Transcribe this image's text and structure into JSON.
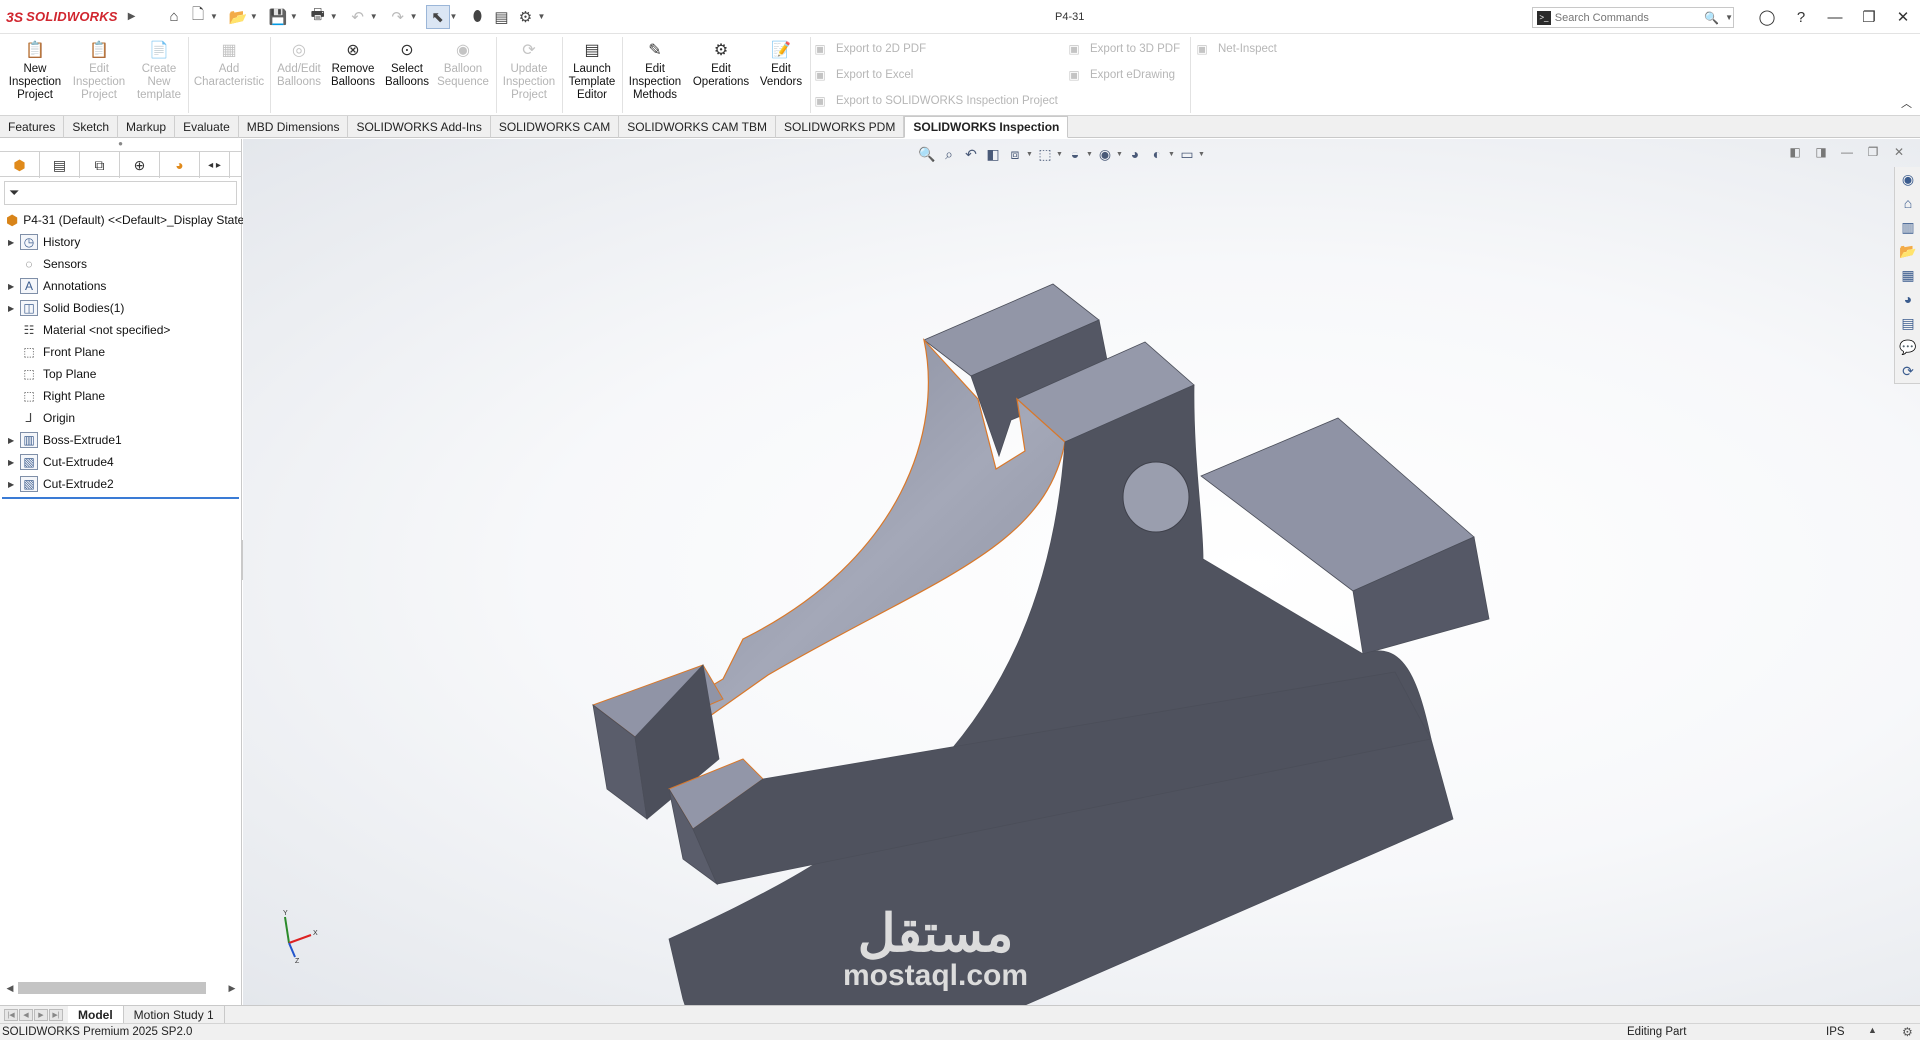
{
  "app": {
    "brand_ds": "3S",
    "brand_name": "SOLIDWORKS",
    "doc_title": "P4-31"
  },
  "search": {
    "placeholder": "Search Commands"
  },
  "ribbon": {
    "new_project": [
      "New",
      "Inspection",
      "Project"
    ],
    "edit_project": [
      "Edit",
      "Inspection",
      "Project"
    ],
    "create_template": [
      "Create",
      "New",
      "template"
    ],
    "add_characteristic": [
      "Add",
      "Characteristic"
    ],
    "add_edit_balloons": [
      "Add/Edit",
      "Balloons"
    ],
    "remove_balloons": [
      "Remove",
      "Balloons"
    ],
    "select_balloons": [
      "Select",
      "Balloons"
    ],
    "balloon_sequence": [
      "Balloon",
      "Sequence"
    ],
    "update_project": [
      "Update",
      "Inspection",
      "Project"
    ],
    "launch_template": [
      "Launch",
      "Template",
      "Editor"
    ],
    "edit_methods": [
      "Edit",
      "Inspection",
      "Methods"
    ],
    "edit_operations": [
      "Edit",
      "Operations"
    ],
    "edit_vendors": [
      "Edit",
      "Vendors"
    ],
    "export_2d_pdf": "Export to 2D PDF",
    "export_excel": "Export to Excel",
    "export_sw_inspection": "Export to SOLIDWORKS Inspection Project",
    "export_3d_pdf": "Export to 3D PDF",
    "export_edrawing": "Export eDrawing",
    "net_inspect": "Net-Inspect"
  },
  "tabs": [
    "Features",
    "Sketch",
    "Markup",
    "Evaluate",
    "MBD Dimensions",
    "SOLIDWORKS Add-Ins",
    "SOLIDWORKS CAM",
    "SOLIDWORKS CAM TBM",
    "SOLIDWORKS PDM",
    "SOLIDWORKS Inspection"
  ],
  "tree": {
    "root": "P4-31 (Default) <<Default>_Display State",
    "items": [
      "History",
      "Sensors",
      "Annotations",
      "Solid Bodies(1)",
      "Material <not specified>",
      "Front Plane",
      "Top Plane",
      "Right Plane",
      "Origin",
      "Boss-Extrude1",
      "Cut-Extrude4",
      "Cut-Extrude2"
    ]
  },
  "triad": {
    "y": "Y",
    "x": "X",
    "z": "Z"
  },
  "watermark": {
    "arabic": "مستقل",
    "latin": "mostaql.com"
  },
  "bottom_tabs": [
    "Model",
    "Motion Study 1"
  ],
  "status": {
    "left": "SOLIDWORKS Premium 2025 SP2.0",
    "mode": "Editing Part",
    "units": "IPS"
  },
  "colors": {
    "brand": "#d1262f",
    "model_face_dark": "#4f525f",
    "model_face_light": "#8e92a3",
    "edge_highlight": "#d9782a",
    "selection_line": "#3a7bd5"
  }
}
